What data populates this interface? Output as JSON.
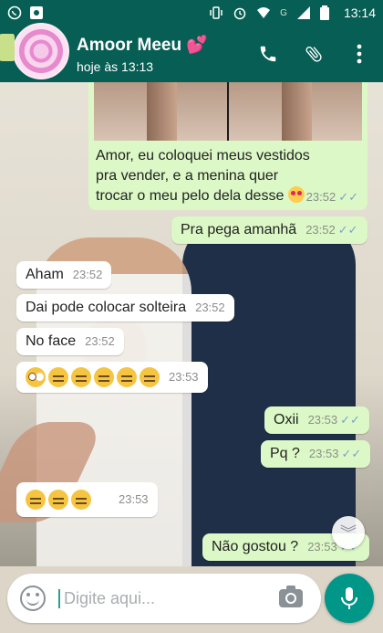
{
  "status_bar": {
    "time": "13:14",
    "network": "G"
  },
  "header": {
    "contact_name": "Amoor Meeu 💕",
    "last_seen": "hoje às 13:13"
  },
  "messages": [
    {
      "direction": "out",
      "text": "Amor, eu coloquei meus vestidos pra vender, e a menina quer trocar o meu pelo dela desse",
      "time": "23:52",
      "has_image": true
    },
    {
      "direction": "out",
      "text": "Pra pega amanhã",
      "time": "23:52"
    },
    {
      "direction": "in",
      "text": "Aham",
      "time": "23:52"
    },
    {
      "direction": "in",
      "text": "Dai pode colocar solteira",
      "time": "23:52"
    },
    {
      "direction": "in",
      "text": "No face",
      "time": "23:52"
    },
    {
      "direction": "in",
      "text": "",
      "emoji": [
        "rolling-eyes",
        "unamused",
        "unamused",
        "unamused",
        "unamused",
        "unamused"
      ],
      "time": "23:53"
    },
    {
      "direction": "out",
      "text": "Oxii",
      "time": "23:53"
    },
    {
      "direction": "out",
      "text": "Pq ?",
      "time": "23:53"
    },
    {
      "direction": "in",
      "text": "",
      "emoji": [
        "unamused",
        "unamused",
        "unamused"
      ],
      "time": "23:53"
    },
    {
      "direction": "out",
      "text": "Não gostou ?",
      "time": "23:53"
    }
  ],
  "input": {
    "placeholder": "Digite aqui..."
  },
  "colors": {
    "header": "#075e54",
    "outgoing": "#dcf8c6",
    "incoming": "#ffffff",
    "fab": "#009688"
  }
}
